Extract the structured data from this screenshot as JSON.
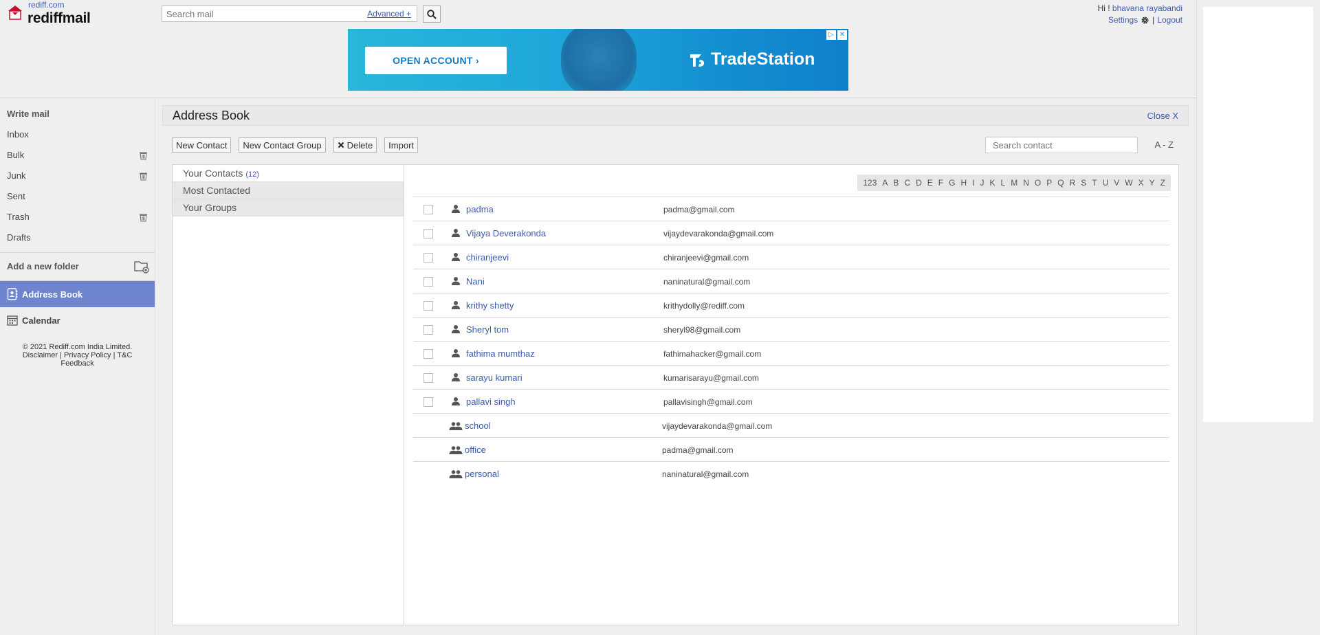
{
  "header": {
    "site_link": "rediff.com",
    "brand": "rediffmail",
    "search_placeholder": "Search mail",
    "advanced_label": "Advanced +",
    "greeting": "Hi !",
    "user_name": "bhavana rayabandi",
    "settings_label": "Settings",
    "separator": "|",
    "logout_label": "Logout"
  },
  "ad": {
    "cta_label": "OPEN ACCOUNT  ›",
    "brand": "TradeStation"
  },
  "sidebar": {
    "write_mail": "Write mail",
    "items": [
      {
        "label": "Inbox",
        "trash": false
      },
      {
        "label": "Bulk",
        "trash": true
      },
      {
        "label": "Junk",
        "trash": true
      },
      {
        "label": "Sent",
        "trash": false
      },
      {
        "label": "Trash",
        "trash": true
      },
      {
        "label": "Drafts",
        "trash": false
      }
    ],
    "add_folder": "Add a new folder",
    "address_book": "Address Book",
    "calendar": "Calendar",
    "footer": {
      "copyright": "© 2021 Rediff.com India Limited.",
      "disclaimer": "Disclaimer",
      "privacy": "Privacy Policy",
      "tc": "T&C",
      "feedback": "Feedback",
      "sep": "|"
    }
  },
  "main": {
    "title": "Address Book",
    "close_label": "Close X",
    "toolbar": {
      "new_contact": "New Contact",
      "new_group": "New Contact Group",
      "delete": "Delete",
      "import": "Import"
    },
    "search_placeholder": "Search contact",
    "az_label": "A - Z",
    "left_list": {
      "your_contacts": "Your Contacts",
      "contacts_count": "(12)",
      "most_contacted": "Most Contacted",
      "your_groups": "Your Groups"
    },
    "alphabet": [
      "123",
      "A",
      "B",
      "C",
      "D",
      "E",
      "F",
      "G",
      "H",
      "I",
      "J",
      "K",
      "L",
      "M",
      "N",
      "O",
      "P",
      "Q",
      "R",
      "S",
      "T",
      "U",
      "V",
      "W",
      "X",
      "Y",
      "Z"
    ],
    "contacts": [
      {
        "name": "padma",
        "email": "padma@gmail.com"
      },
      {
        "name": "Vijaya Deverakonda",
        "email": "vijaydevarakonda@gmail.com"
      },
      {
        "name": "chiranjeevi",
        "email": "chiranjeevi@gmail.com"
      },
      {
        "name": "Nani",
        "email": "naninatural@gmail.com"
      },
      {
        "name": "krithy shetty",
        "email": "krithydolly@rediff.com"
      },
      {
        "name": "Sheryl tom",
        "email": "sheryl98@gmail.com"
      },
      {
        "name": "fathima mumthaz",
        "email": "fathimahacker@gmail.com"
      },
      {
        "name": "sarayu kumari",
        "email": "kumarisarayu@gmail.com"
      },
      {
        "name": "pallavi singh",
        "email": "pallavisingh@gmail.com"
      }
    ],
    "groups": [
      {
        "name": "school",
        "email": "vijaydevarakonda@gmail.com"
      },
      {
        "name": "office",
        "email": "padma@gmail.com"
      },
      {
        "name": "personal",
        "email": "naninatural@gmail.com"
      }
    ]
  },
  "colors": {
    "accent": "#6e84cf",
    "link": "#3b5bb0"
  }
}
